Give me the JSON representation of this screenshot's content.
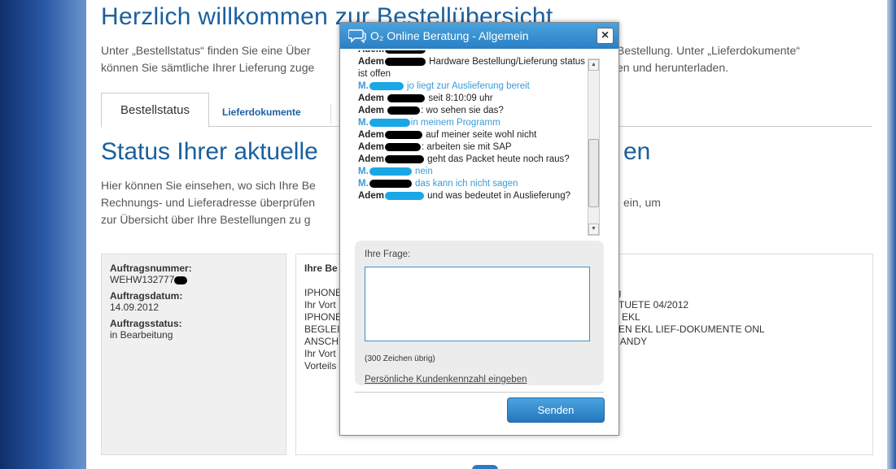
{
  "page": {
    "title": "Herzlich willkommen zur Bestellübersicht",
    "intro_line1_left": "Unter „Bestellstatus“ finden Sie eine Über",
    "intro_line1_right": "Bestellung. Unter „Lieferdokumente“",
    "intro_line2_left": "können Sie sämtliche Ihrer Lieferung zuge",
    "intro_line2_right": "en und herunterladen.",
    "tabs": [
      {
        "label": "Bestellstatus"
      },
      {
        "label": "Lieferdokumente"
      }
    ],
    "section_title_left": "Status Ihrer aktuelle",
    "section_title_right": "en",
    "desc_lines": [
      {
        "left": "Hier können Sie einsehen, wo sich Ihre Be",
        "right": ""
      },
      {
        "left": "Rechnungs- und Lieferadresse überprüfen",
        "right": "ein, um"
      },
      {
        "left": "zur Übersicht über Ihre Bestellungen zu g",
        "right": ""
      }
    ],
    "order": {
      "number_label": "Auftragsnummer:",
      "number_value": "WEHW132777",
      "date_label": "Auftragsdatum:",
      "date_value": "14.09.2012",
      "status_label": "Auftragsstatus:",
      "status_value": "in Bearbeitung"
    },
    "items": {
      "heading": "Ihre Be",
      "left_rows": [
        "IPHONE",
        "Ihr Vort",
        "IPHONE",
        "BEGLEIT",
        "ANSCHI",
        "Ihr Vort",
        "Vorteils"
      ],
      "right_rows": [
        "ertrag",
        "LINGTUETE 04/2012",
        "HEIN EKL",
        "REIBEN EKL LIEF-DOKUMENTE ONL",
        "MY HANDY",
        "EN"
      ]
    }
  },
  "chat": {
    "title": "O₂ Online Beratung - Allgemein",
    "close": "×",
    "messages": [
      {
        "who": "cust",
        "name": "Adem",
        "text": "Hardware Bestellung/Lieferung status ist offen"
      },
      {
        "who": "agent",
        "name": "M.",
        "text": "jo liegt zur Auslieferung bereit"
      },
      {
        "who": "cust",
        "name": "Adem",
        "text": "seit 8:10:09 uhr"
      },
      {
        "who": "cust",
        "name": "Adem",
        "text": "wo sehen sie das?"
      },
      {
        "who": "agent",
        "name": "M.",
        "text": "in meinem Programm"
      },
      {
        "who": "cust",
        "name": "Adem",
        "text": "auf meiner seite wohl nicht"
      },
      {
        "who": "cust",
        "name": "Adem",
        "text": "arbeiten sie mit SAP"
      },
      {
        "who": "cust",
        "name": "Adem",
        "text": "geht das Packet heute noch raus?"
      },
      {
        "who": "agent",
        "name": "M.",
        "text": "nein"
      },
      {
        "who": "agent",
        "name": "M.",
        "text": "das kann ich nicht sagen"
      },
      {
        "who": "cust",
        "name": "Adem",
        "text": "und was bedeutet in Auslieferung?"
      }
    ],
    "question_label": "Ihre Frage:",
    "question_value": "",
    "chars_left": "(300 Zeichen übrig)",
    "customer_id_link": "Persönliche Kundenkennzahl eingeben",
    "send_label": "Senden"
  },
  "colors": {
    "brand": "#1a5f9e",
    "agent": "#3a9bd8",
    "button": "#2a7fc4"
  }
}
